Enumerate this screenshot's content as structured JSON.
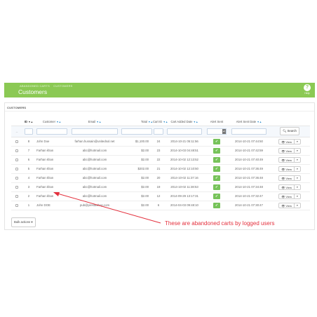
{
  "header": {
    "breadcrumb": [
      "ABANDONED CARTS",
      "CUSTOMERS"
    ],
    "title": "Customers",
    "help_icon": "?",
    "help_label": "Help"
  },
  "panel": {
    "heading": "CUSTOMERS"
  },
  "table": {
    "columns": {
      "id": "ID",
      "customer": "Customer",
      "email": "Email",
      "total": "Total",
      "cart_id": "Cart ID",
      "cart_added_date": "Cart Added Date",
      "alert_sent": "Alert Sent",
      "alert_sent_date": "Alert Sent Date"
    },
    "filter": {
      "dash": "--",
      "search_label": "Search"
    },
    "rows": [
      {
        "id": "8",
        "customer": "John Doe",
        "email": "farhan.hussain@unitedsol.net",
        "total": "$1,100.00",
        "cart_id": "24",
        "cart_added_date": "2014-10-21 05:11:56",
        "alert_sent_date": "2014-10-21 07:44:50"
      },
      {
        "id": "7",
        "customer": "Farhan khan",
        "email": "abc@hotmail.com",
        "total": "$2.00",
        "cart_id": "23",
        "cart_added_date": "2014-10-03 04:48:51",
        "alert_sent_date": "2014-10-21 07:42:59"
      },
      {
        "id": "6",
        "customer": "Farhan khan",
        "email": "abc@hotmail.com",
        "total": "$2.00",
        "cart_id": "22",
        "cart_added_date": "2014-10-02 12:13:52",
        "alert_sent_date": "2014-10-21 07:40:49"
      },
      {
        "id": "5",
        "customer": "Farhan khan",
        "email": "abc@hotmail.com",
        "total": "$202.00",
        "cart_id": "21",
        "cart_added_date": "2014-10-02 12:10:50",
        "alert_sent_date": "2014-10-21 07:36:49"
      },
      {
        "id": "4",
        "customer": "Farhan khan",
        "email": "abc@hotmail.com",
        "total": "$2.00",
        "cart_id": "20",
        "cart_added_date": "2014-10-02 11:37:16",
        "alert_sent_date": "2014-10-21 07:36:48"
      },
      {
        "id": "3",
        "customer": "Farhan khan",
        "email": "abc@hotmail.com",
        "total": "$2.00",
        "cart_id": "19",
        "cart_added_date": "2014-10-02 11:38:53",
        "alert_sent_date": "2014-10-21 07:34:48"
      },
      {
        "id": "2",
        "customer": "Farhan khan",
        "email": "abc@hotmail.com",
        "total": "$2.00",
        "cart_id": "12",
        "cart_added_date": "2014-09-29 13:17:31",
        "alert_sent_date": "2014-10-21 07:32:47"
      },
      {
        "id": "1",
        "customer": "John DOE",
        "email": "pub@prestashop.com",
        "total": "$2.00",
        "cart_id": "6",
        "cart_added_date": "2014-04-03 09:48:10",
        "alert_sent_date": "2014-10-21 07:30:47"
      }
    ],
    "alert_sent_icon": "check-icon",
    "view_label": "View",
    "view_icon": "eye-icon"
  },
  "bulk_actions_label": "Bulk actions",
  "annotation_text": "These are abandoned carts by logged users",
  "colors": {
    "header_green": "#8bc954",
    "alert_green": "#77c35a",
    "annotation_red": "#e4303d",
    "sort_blue": "#2a8bcc"
  }
}
